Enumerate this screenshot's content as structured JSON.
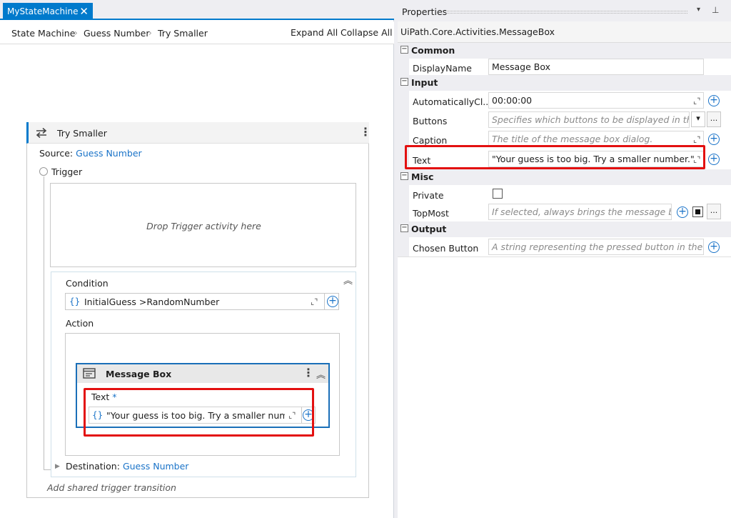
{
  "designer": {
    "tab_label": "MyStateMachine",
    "breadcrumb": [
      "State Machine",
      "Guess Number",
      "Try Smaller"
    ],
    "expand_all": "Expand All",
    "collapse_all": "Collapse All",
    "state": {
      "title": "Try Smaller",
      "source_label": "Source:",
      "source_value": "Guess Number",
      "trigger_label": "Trigger",
      "drop_trigger": "Drop Trigger activity here",
      "condition_label": "Condition",
      "condition_brace": "{}",
      "condition_value": "InitialGuess >RandomNumber",
      "action_label": "Action",
      "message_box": {
        "title": "Message Box",
        "text_label": "Text",
        "required_mark": "*",
        "brace": "{}",
        "text_value": "\"Your guess is too big. Try a smaller numbe"
      },
      "destination_label": "Destination:",
      "destination_value": "Guess Number",
      "add_shared": "Add shared trigger transition"
    }
  },
  "properties": {
    "panel_title": "Properties",
    "activity_type": "UiPath.Core.Activities.MessageBox",
    "categories": {
      "common": "Common",
      "input": "Input",
      "misc": "Misc",
      "output": "Output"
    },
    "rows": {
      "display_name": {
        "name": "DisplayName",
        "value": "Message Box"
      },
      "auto_close": {
        "name": "AutomaticallyCl...",
        "value": "00:00:00"
      },
      "buttons": {
        "name": "Buttons",
        "placeholder": "Specifies which buttons to be displayed in the mes"
      },
      "caption": {
        "name": "Caption",
        "placeholder": "The title of the message box dialog."
      },
      "text": {
        "name": "Text",
        "value": "\"Your guess is too big. Try a smaller number.\""
      },
      "private": {
        "name": "Private"
      },
      "topmost": {
        "name": "TopMost",
        "placeholder": "If selected, always brings the message box to"
      },
      "chosen_button": {
        "name": "Chosen Button",
        "placeholder": "A string representing the pressed button in the messa"
      }
    },
    "ellipsis": "...",
    "dropdown_arrow": "▾"
  },
  "colors": {
    "accent": "#007acc",
    "link": "#1a73c8",
    "highlight": "#e31010"
  }
}
